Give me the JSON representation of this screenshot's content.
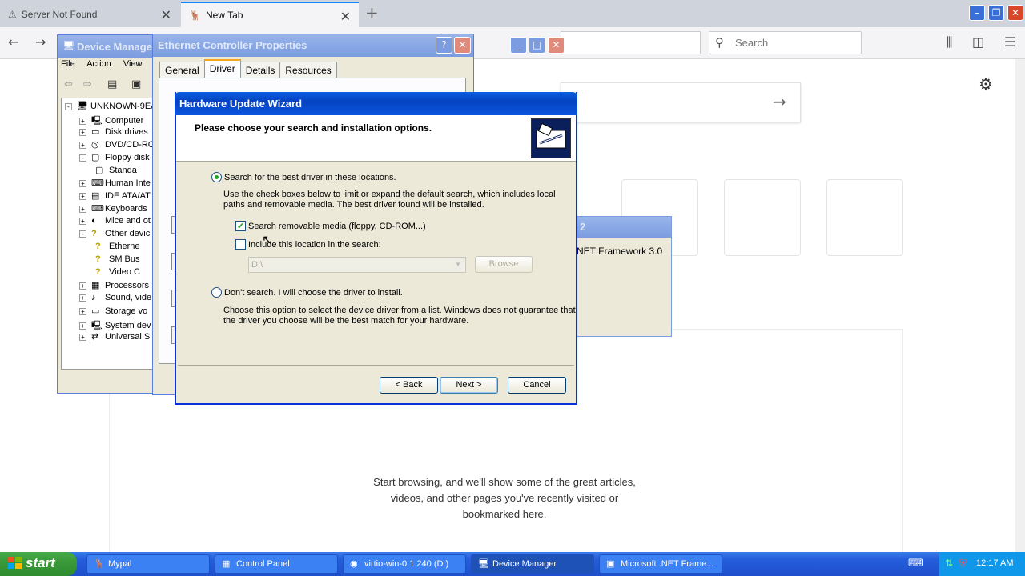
{
  "firefox": {
    "tabs": [
      {
        "label": "Server Not Found"
      },
      {
        "label": "New Tab"
      }
    ],
    "search_placeholder": "Search",
    "empty_message_line1": "Start browsing, and we'll show some of the great articles,",
    "empty_message_line2": "videos, and other pages you've recently visited or",
    "empty_message_line3": "bookmarked here."
  },
  "device_manager": {
    "title": "Device Manager",
    "menu": [
      "File",
      "Action",
      "View"
    ],
    "tree": [
      {
        "label": "UNKNOWN-9EA",
        "level": 0,
        "pm": "-"
      },
      {
        "label": "Computer",
        "level": 1,
        "pm": "+"
      },
      {
        "label": "Disk drives",
        "level": 1,
        "pm": "+"
      },
      {
        "label": "DVD/CD-RO",
        "level": 1,
        "pm": "+"
      },
      {
        "label": "Floppy disk",
        "level": 1,
        "pm": "-"
      },
      {
        "label": "Standa",
        "level": 2,
        "pm": ""
      },
      {
        "label": "Human Inte",
        "level": 1,
        "pm": "+"
      },
      {
        "label": "IDE ATA/AT",
        "level": 1,
        "pm": "+"
      },
      {
        "label": "Keyboards",
        "level": 1,
        "pm": "+"
      },
      {
        "label": "Mice and ot",
        "level": 1,
        "pm": "+"
      },
      {
        "label": "Other devic",
        "level": 1,
        "pm": "-"
      },
      {
        "label": "Etherne",
        "level": 2,
        "pm": ""
      },
      {
        "label": "SM Bus",
        "level": 2,
        "pm": ""
      },
      {
        "label": "Video C",
        "level": 2,
        "pm": ""
      },
      {
        "label": "Processors",
        "level": 1,
        "pm": "+"
      },
      {
        "label": "Sound, vide",
        "level": 1,
        "pm": "+"
      },
      {
        "label": "Storage vo",
        "level": 1,
        "pm": "+"
      },
      {
        "label": "System dev",
        "level": 1,
        "pm": "+"
      },
      {
        "label": "Universal S",
        "level": 1,
        "pm": "+"
      }
    ]
  },
  "ethernet_props": {
    "title": "Ethernet Controller Properties",
    "tabs": [
      "General",
      "Driver",
      "Details",
      "Resources"
    ],
    "active_tab": "Driver"
  },
  "net_window": {
    "title_fragment": "2",
    "text": "NET Framework 3.0"
  },
  "wizard": {
    "title": "Hardware Update Wizard",
    "heading": "Please choose your search and installation options.",
    "option1_label": "Search for the best driver in these locations.",
    "option1_desc_line1": "Use the check boxes below to limit or expand the default search, which includes local",
    "option1_desc_line2": "paths and removable media. The best driver found will be installed.",
    "check1_label": "Search removable media (floppy, CD-ROM...)",
    "check1_checked": true,
    "check2_label": "Include this location in the search:",
    "check2_checked": false,
    "path_value": "D:\\",
    "browse_label": "Browse",
    "option2_label": "Don't search. I will choose the driver to install.",
    "option2_desc_line1": "Choose this option to select the device driver from a list.  Windows does not guarantee that",
    "option2_desc_line2": "the driver you choose will be the best match for your hardware.",
    "selected_option": "search",
    "back_label": "< Back",
    "next_label": "Next >",
    "cancel_label": "Cancel"
  },
  "taskbar": {
    "start_label": "start",
    "tasks": [
      {
        "label": "Mypal",
        "icon": "firefox-icon"
      },
      {
        "label": "Control Panel",
        "icon": "control-panel-icon"
      },
      {
        "label": "virtio-win-0.1.240 (D:)",
        "icon": "cd-icon"
      },
      {
        "label": "Device Manager",
        "icon": "device-manager-icon"
      },
      {
        "label": "Microsoft .NET Frame...",
        "icon": "installer-icon"
      }
    ],
    "active_task": "Device Manager",
    "clock": "12:17 AM"
  },
  "colors": {
    "xp_title_blue": "#0442c0",
    "xp_face": "#ece9d8",
    "taskbar_blue": "#245edb",
    "start_green": "#3a9a3a",
    "firefox_accent": "#0a84ff"
  }
}
